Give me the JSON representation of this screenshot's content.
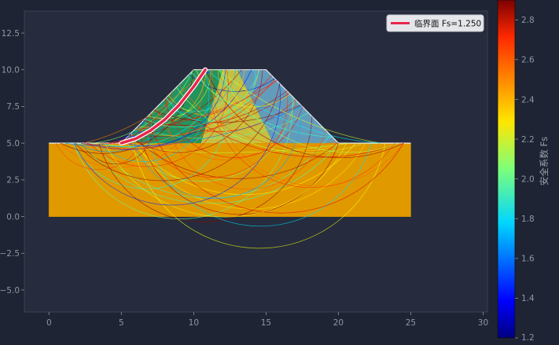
{
  "chart_data": {
    "type": "slope-stability",
    "xlim": [
      -1.7,
      30.3
    ],
    "ylim": [
      -6.5,
      14.0
    ],
    "xticks": [
      "0",
      "5",
      "10",
      "15",
      "20",
      "25",
      "30"
    ],
    "xtick_values": [
      0,
      5,
      10,
      15,
      20,
      25,
      30
    ],
    "yticks": [
      "−5.0",
      "−2.5",
      "0.0",
      "2.5",
      "5.0",
      "7.5",
      "10.0",
      "12.5"
    ],
    "ytick_values": [
      -5,
      -2.5,
      0,
      2.5,
      5,
      7.5,
      10,
      12.5
    ],
    "grid": false,
    "legend": {
      "position": "top-right",
      "entries": [
        {
          "label": "临界面 Fs=1.250",
          "color": "#e8254a"
        }
      ]
    },
    "foundation": {
      "polygon": [
        [
          0,
          0
        ],
        [
          25,
          0
        ],
        [
          25,
          5
        ],
        [
          0,
          5
        ]
      ],
      "color": "#e09a00"
    },
    "embankment_zones": [
      {
        "polygon": [
          [
            5,
            5
          ],
          [
            10,
            10
          ],
          [
            12,
            10
          ],
          [
            10.5,
            5
          ]
        ],
        "color": "#22a060"
      },
      {
        "polygon": [
          [
            10.5,
            5
          ],
          [
            12,
            10
          ],
          [
            13,
            10
          ],
          [
            15.5,
            5
          ]
        ],
        "color": "#d8d040"
      },
      {
        "polygon": [
          [
            15.5,
            5
          ],
          [
            13,
            10
          ],
          [
            15,
            10
          ],
          [
            20,
            5
          ]
        ],
        "color": "#6aa8c8"
      }
    ],
    "critical_surface": {
      "fs": 1.25,
      "points": [
        [
          5,
          5
        ],
        [
          6,
          5.3
        ],
        [
          7,
          5.85
        ],
        [
          8,
          6.6
        ],
        [
          9,
          7.6
        ],
        [
          10,
          8.85
        ],
        [
          10.8,
          10
        ]
      ]
    },
    "colorbar": {
      "label": "安全系数 Fs",
      "min": 1.2,
      "max": 2.9,
      "ticks": [
        "1.2",
        "1.4",
        "1.6",
        "1.8",
        "2.0",
        "2.2",
        "2.4",
        "2.6",
        "2.8"
      ],
      "tick_values": [
        1.2,
        1.4,
        1.6,
        1.8,
        2.0,
        2.2,
        2.4,
        2.6,
        2.8
      ]
    }
  }
}
